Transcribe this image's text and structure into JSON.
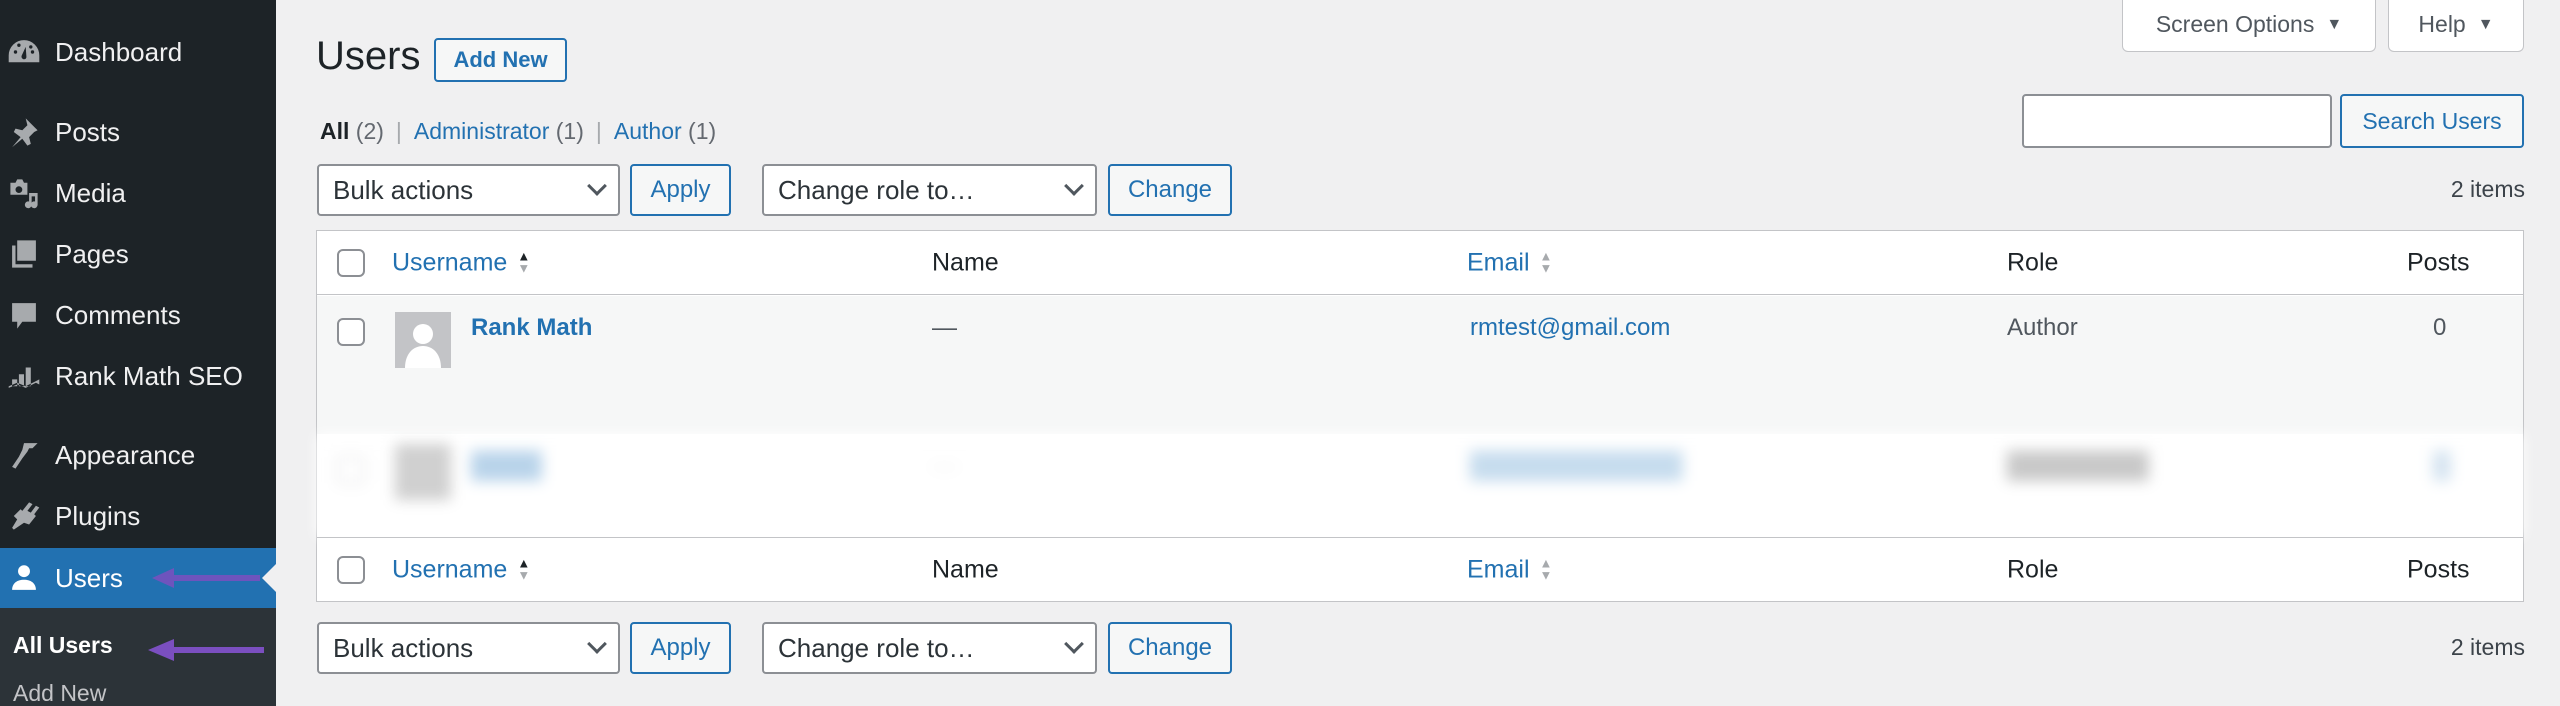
{
  "sidebar": {
    "items": [
      {
        "label": "Dashboard",
        "icon": "dashboard-gauge-icon"
      },
      {
        "label": "Posts",
        "icon": "pushpin-icon"
      },
      {
        "label": "Media",
        "icon": "media-camera-music-icon"
      },
      {
        "label": "Pages",
        "icon": "pages-icon"
      },
      {
        "label": "Comments",
        "icon": "comment-bubble-icon"
      },
      {
        "label": "Rank Math SEO",
        "icon": "rank-math-chart-icon"
      },
      {
        "label": "Appearance",
        "icon": "paintbrush-icon"
      },
      {
        "label": "Plugins",
        "icon": "plug-icon"
      },
      {
        "label": "Users",
        "icon": "user-icon",
        "active": true
      }
    ],
    "submenu": [
      {
        "label": "All Users",
        "current": true
      },
      {
        "label": "Add New"
      }
    ]
  },
  "screen_meta": {
    "screen_options": "Screen Options",
    "help": "Help",
    "caret": "▼"
  },
  "header": {
    "title": "Users",
    "add_new": "Add New"
  },
  "views": [
    {
      "label": "All",
      "count": "(2)",
      "current": true
    },
    {
      "label": "Administrator",
      "count": "(1)"
    },
    {
      "label": "Author",
      "count": "(1)"
    }
  ],
  "view_separator": "|",
  "search": {
    "value": "",
    "button": "Search Users"
  },
  "tablenav": {
    "bulk_actions": "Bulk actions",
    "apply": "Apply",
    "change_role": "Change role to…",
    "change": "Change",
    "items_count": "2 items"
  },
  "table": {
    "columns": {
      "username": "Username",
      "name": "Name",
      "email": "Email",
      "role": "Role",
      "posts": "Posts"
    },
    "rows": [
      {
        "username": "Rank Math",
        "name": "—",
        "email": "rmtest@gmail.com",
        "role": "Author",
        "posts": "0",
        "blurred": false
      },
      {
        "username": "████",
        "name": "—",
        "email": "████████████",
        "role": "████████",
        "posts": "█",
        "blurred": true
      }
    ]
  },
  "annotations": {
    "arrow_color": "#7b4fc0"
  },
  "colors": {
    "sidebar_bg": "#1d2327",
    "active_menu": "#2271b1",
    "link": "#2271b1",
    "page_bg": "#f0f0f1"
  }
}
